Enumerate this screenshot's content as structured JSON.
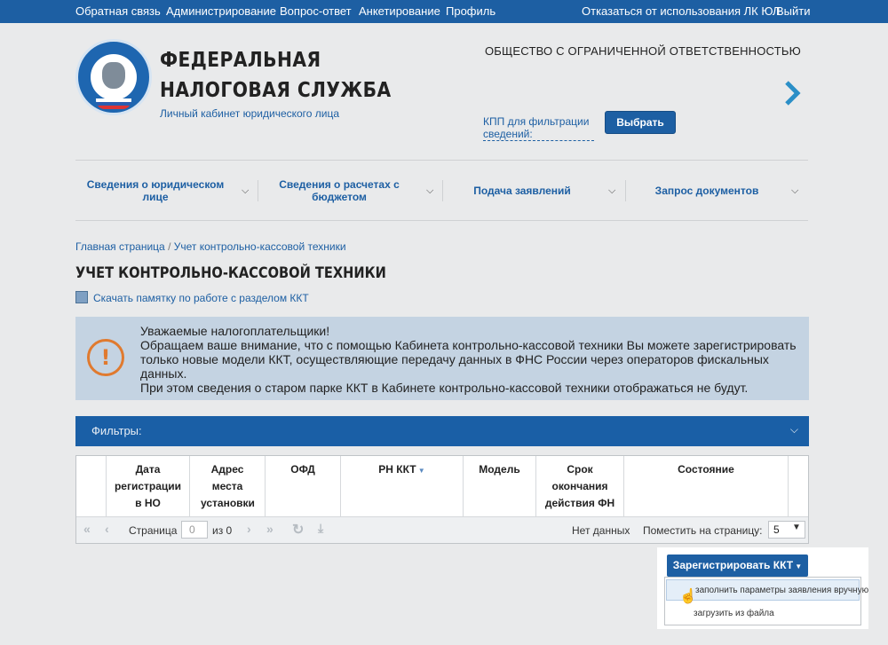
{
  "topbar": {
    "links": [
      "Обратная связь",
      "Администрирование",
      "Вопрос-ответ",
      "Анкетирование",
      "Профиль"
    ],
    "right_links": [
      "Отказаться от использования ЛК ЮЛ",
      "Выйти"
    ]
  },
  "header": {
    "brand_line1": "ФЕДЕРАЛЬНАЯ",
    "brand_line2": "НАЛОГОВАЯ СЛУЖБА",
    "subtitle": "Личный кабинет юридического лица",
    "org_name": "ОБЩЕСТВО С ОГРАНИЧЕННОЙ ОТВЕТСТВЕННОСТЬЮ",
    "kpp_link": "КПП для фильтрации сведений:",
    "select_button": "Выбрать"
  },
  "nav": {
    "items": [
      "Сведения о юридическом лице",
      "Сведения о расчетах с бюджетом",
      "Подача заявлений",
      "Запрос документов"
    ]
  },
  "breadcrumb": {
    "home": "Главная страница",
    "separator": "/",
    "current": "Учет контрольно-кассовой техники"
  },
  "page_title": "УЧЕТ КОНТРОЛЬНО-КАССОВОЙ ТЕХНИКИ",
  "download_link": "Скачать памятку по работе с разделом ККТ",
  "notice": {
    "icon": "exclamation-icon",
    "line1": "Уважаемые налогоплательщики!",
    "line2": "Обращаем ваше внимание, что с помощью Кабинета контрольно-кассовой техники Вы можете зарегистрировать только новые модели ККТ, осуществляющие передачу данных в ФНС России через операторов фискальных данных.",
    "line3": "При этом сведения о старом парке ККТ в Кабинете контрольно-кассовой техники отображаться не будут."
  },
  "filters": {
    "label": "Фильтры:"
  },
  "table": {
    "columns": [
      "Дата регистрации в НО",
      "Адрес места установки",
      "ОФД",
      "РН ККТ",
      "Модель",
      "Срок окончания действия ФН",
      "Состояние"
    ],
    "pager": {
      "page_label": "Страница",
      "page_value": "0",
      "of_label": "из 0",
      "no_data": "Нет данных",
      "per_page_label": "Поместить на страницу:",
      "per_page_value": "5"
    }
  },
  "register": {
    "button": "Зарегистрировать ККТ",
    "menu": [
      "заполнить параметры заявления вручную",
      "загрузить из файла"
    ]
  },
  "colors": {
    "primary": "#1d5fa3",
    "warning": "#e07a2f",
    "notice_bg": "#c4d3e2"
  }
}
